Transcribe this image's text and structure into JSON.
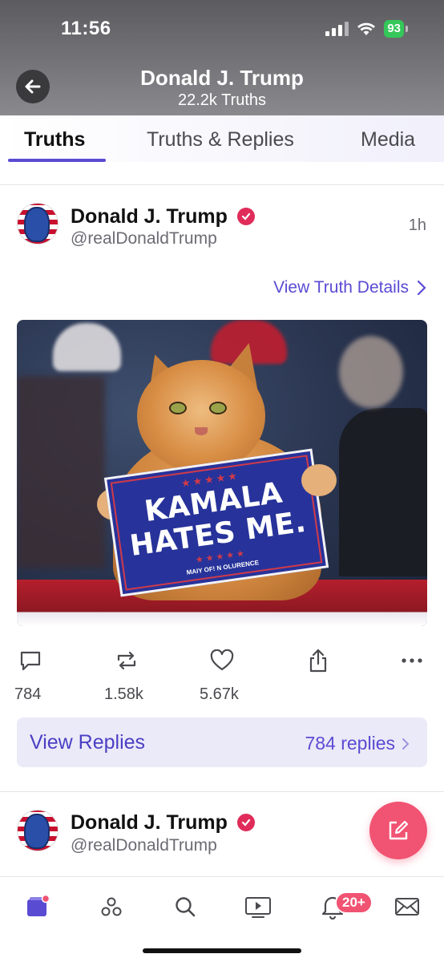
{
  "status_bar": {
    "time": "11:56",
    "battery": "93"
  },
  "header": {
    "title": "Donald J. Trump",
    "subtitle": "22.2k Truths"
  },
  "tabs": [
    {
      "label": "Truths",
      "active": true
    },
    {
      "label": "Truths & Replies",
      "active": false
    },
    {
      "label": "Media",
      "active": false
    }
  ],
  "post": {
    "author_name": "Donald J. Trump",
    "handle": "@realDonaldTrump",
    "time": "1h",
    "details_link": "View Truth Details",
    "image": {
      "sign_line1": "KAMALA",
      "sign_line2": "HATES ME.",
      "sign_stars": "★★★★★",
      "sign_footer": "MAIY OF! N OLURENCE"
    },
    "counts": {
      "replies": "784",
      "retruths": "1.58k",
      "likes": "5.67k"
    },
    "view_replies_label": "View Replies",
    "replies_count_label": "784 replies"
  },
  "next_post": {
    "author_name": "Donald J. Trump",
    "handle": "@realDonaldTrump"
  },
  "bottom_nav": {
    "notifications_badge": "20+"
  },
  "colors": {
    "accent": "#5a4bd3",
    "verified": "#e02c5a",
    "fab": "#f15372",
    "battery": "#34c759"
  }
}
